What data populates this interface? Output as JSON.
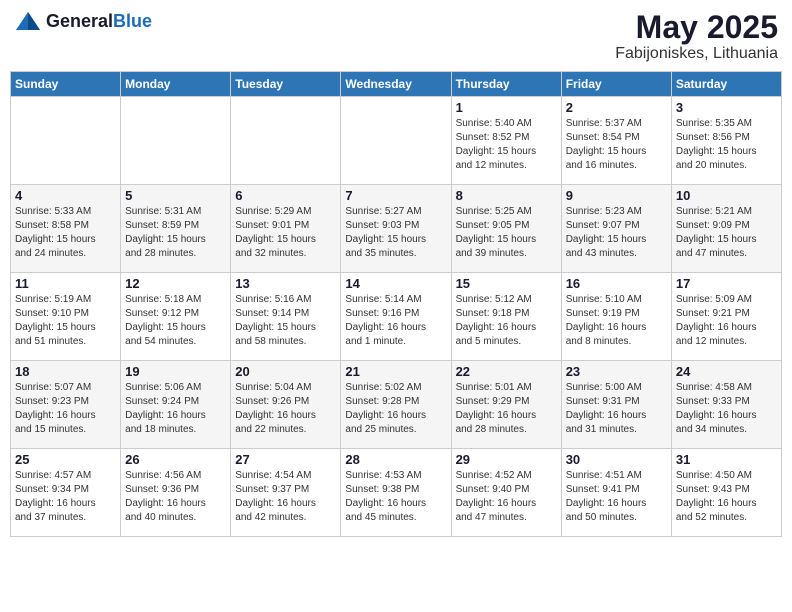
{
  "header": {
    "logo_general": "General",
    "logo_blue": "Blue",
    "month_title": "May 2025",
    "location": "Fabijoniskes, Lithuania"
  },
  "weekdays": [
    "Sunday",
    "Monday",
    "Tuesday",
    "Wednesday",
    "Thursday",
    "Friday",
    "Saturday"
  ],
  "weeks": [
    [
      {
        "day": "",
        "info": ""
      },
      {
        "day": "",
        "info": ""
      },
      {
        "day": "",
        "info": ""
      },
      {
        "day": "",
        "info": ""
      },
      {
        "day": "1",
        "info": "Sunrise: 5:40 AM\nSunset: 8:52 PM\nDaylight: 15 hours\nand 12 minutes."
      },
      {
        "day": "2",
        "info": "Sunrise: 5:37 AM\nSunset: 8:54 PM\nDaylight: 15 hours\nand 16 minutes."
      },
      {
        "day": "3",
        "info": "Sunrise: 5:35 AM\nSunset: 8:56 PM\nDaylight: 15 hours\nand 20 minutes."
      }
    ],
    [
      {
        "day": "4",
        "info": "Sunrise: 5:33 AM\nSunset: 8:58 PM\nDaylight: 15 hours\nand 24 minutes."
      },
      {
        "day": "5",
        "info": "Sunrise: 5:31 AM\nSunset: 8:59 PM\nDaylight: 15 hours\nand 28 minutes."
      },
      {
        "day": "6",
        "info": "Sunrise: 5:29 AM\nSunset: 9:01 PM\nDaylight: 15 hours\nand 32 minutes."
      },
      {
        "day": "7",
        "info": "Sunrise: 5:27 AM\nSunset: 9:03 PM\nDaylight: 15 hours\nand 35 minutes."
      },
      {
        "day": "8",
        "info": "Sunrise: 5:25 AM\nSunset: 9:05 PM\nDaylight: 15 hours\nand 39 minutes."
      },
      {
        "day": "9",
        "info": "Sunrise: 5:23 AM\nSunset: 9:07 PM\nDaylight: 15 hours\nand 43 minutes."
      },
      {
        "day": "10",
        "info": "Sunrise: 5:21 AM\nSunset: 9:09 PM\nDaylight: 15 hours\nand 47 minutes."
      }
    ],
    [
      {
        "day": "11",
        "info": "Sunrise: 5:19 AM\nSunset: 9:10 PM\nDaylight: 15 hours\nand 51 minutes."
      },
      {
        "day": "12",
        "info": "Sunrise: 5:18 AM\nSunset: 9:12 PM\nDaylight: 15 hours\nand 54 minutes."
      },
      {
        "day": "13",
        "info": "Sunrise: 5:16 AM\nSunset: 9:14 PM\nDaylight: 15 hours\nand 58 minutes."
      },
      {
        "day": "14",
        "info": "Sunrise: 5:14 AM\nSunset: 9:16 PM\nDaylight: 16 hours\nand 1 minute."
      },
      {
        "day": "15",
        "info": "Sunrise: 5:12 AM\nSunset: 9:18 PM\nDaylight: 16 hours\nand 5 minutes."
      },
      {
        "day": "16",
        "info": "Sunrise: 5:10 AM\nSunset: 9:19 PM\nDaylight: 16 hours\nand 8 minutes."
      },
      {
        "day": "17",
        "info": "Sunrise: 5:09 AM\nSunset: 9:21 PM\nDaylight: 16 hours\nand 12 minutes."
      }
    ],
    [
      {
        "day": "18",
        "info": "Sunrise: 5:07 AM\nSunset: 9:23 PM\nDaylight: 16 hours\nand 15 minutes."
      },
      {
        "day": "19",
        "info": "Sunrise: 5:06 AM\nSunset: 9:24 PM\nDaylight: 16 hours\nand 18 minutes."
      },
      {
        "day": "20",
        "info": "Sunrise: 5:04 AM\nSunset: 9:26 PM\nDaylight: 16 hours\nand 22 minutes."
      },
      {
        "day": "21",
        "info": "Sunrise: 5:02 AM\nSunset: 9:28 PM\nDaylight: 16 hours\nand 25 minutes."
      },
      {
        "day": "22",
        "info": "Sunrise: 5:01 AM\nSunset: 9:29 PM\nDaylight: 16 hours\nand 28 minutes."
      },
      {
        "day": "23",
        "info": "Sunrise: 5:00 AM\nSunset: 9:31 PM\nDaylight: 16 hours\nand 31 minutes."
      },
      {
        "day": "24",
        "info": "Sunrise: 4:58 AM\nSunset: 9:33 PM\nDaylight: 16 hours\nand 34 minutes."
      }
    ],
    [
      {
        "day": "25",
        "info": "Sunrise: 4:57 AM\nSunset: 9:34 PM\nDaylight: 16 hours\nand 37 minutes."
      },
      {
        "day": "26",
        "info": "Sunrise: 4:56 AM\nSunset: 9:36 PM\nDaylight: 16 hours\nand 40 minutes."
      },
      {
        "day": "27",
        "info": "Sunrise: 4:54 AM\nSunset: 9:37 PM\nDaylight: 16 hours\nand 42 minutes."
      },
      {
        "day": "28",
        "info": "Sunrise: 4:53 AM\nSunset: 9:38 PM\nDaylight: 16 hours\nand 45 minutes."
      },
      {
        "day": "29",
        "info": "Sunrise: 4:52 AM\nSunset: 9:40 PM\nDaylight: 16 hours\nand 47 minutes."
      },
      {
        "day": "30",
        "info": "Sunrise: 4:51 AM\nSunset: 9:41 PM\nDaylight: 16 hours\nand 50 minutes."
      },
      {
        "day": "31",
        "info": "Sunrise: 4:50 AM\nSunset: 9:43 PM\nDaylight: 16 hours\nand 52 minutes."
      }
    ]
  ]
}
